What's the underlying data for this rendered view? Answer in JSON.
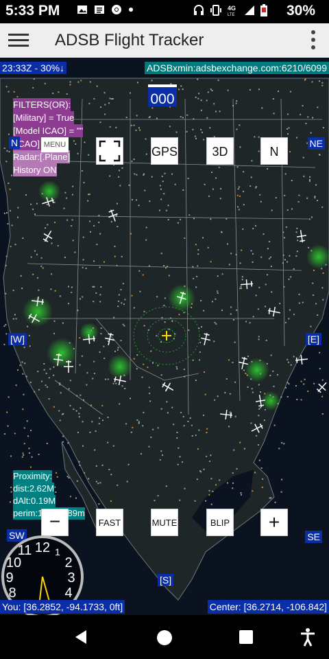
{
  "status": {
    "time": "5:33 PM",
    "battery": "30%",
    "network": "4G LTE",
    "left_icons": [
      "image-icon",
      "message-icon",
      "chrome-icon",
      "dot-icon"
    ],
    "right_icons": [
      "headphones-icon",
      "vibrate-icon",
      "network-icon",
      "signal-icon",
      "battery-icon"
    ]
  },
  "appbar": {
    "title": "ADSB Flight Tracker"
  },
  "map": {
    "top_left_info": "23:33Z - 30%↓",
    "top_right_info": "ADSBxmin:adsbexchange.com:6210/6099",
    "aircraft_count": "000",
    "filters": [
      "FILTERS(OR):",
      " [Military] = True",
      " [Model ICAO] = \"\"",
      " [ICAO] = \"\"",
      "Radar:[.Plane]",
      "History ON"
    ],
    "menu_label": "MENU",
    "buttons_top": {
      "fullscreen": "",
      "gps": "GPS",
      "three_d": "3D",
      "north": "N"
    },
    "buttons_bottom": {
      "zoom_out": "−",
      "fast": "FAST",
      "mute": "MUTE",
      "blip": "BLIP",
      "zoom_in": "+"
    },
    "compass": {
      "nw": "N",
      "ne": "NE",
      "w": "[W]",
      "e": "[E]",
      "sw": "SW",
      "se": "SE",
      "s": "[S]"
    },
    "proximity": [
      "Proximity:",
      "dist:2.62M",
      "dAlt:0.19M",
      "perim:16183989m"
    ],
    "you_info": "You: [36.2852, -94.1733, 0ft]",
    "center_info": "Center: [36.2714, -106.842]"
  },
  "clock": {
    "numbers": [
      "12",
      "1",
      "2",
      "3",
      "4",
      "8",
      "9",
      "10",
      "11"
    ]
  },
  "colors": {
    "accent_blue": "#0a2da8",
    "teal": "#008080",
    "purple": "#8d3c92",
    "map_bg": "#0b1320",
    "radar_green": "#2fd02f"
  },
  "nav": {
    "buttons": [
      "back-icon",
      "home-icon",
      "recents-icon",
      "accessibility-icon"
    ]
  }
}
